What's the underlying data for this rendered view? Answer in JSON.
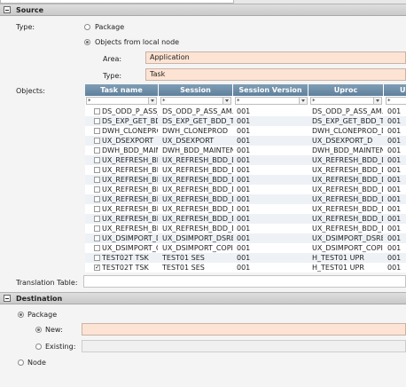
{
  "source": {
    "title": "Source",
    "type_label": "Type:",
    "type_options": [
      "Package",
      "Objects from local node"
    ],
    "area_label": "Area:",
    "area_value": "Application",
    "objtype_label": "Type:",
    "objtype_value": "Task",
    "objects_label": "Objects:",
    "translation_label": "Translation Table:"
  },
  "grid": {
    "columns": [
      "Task name",
      "Session",
      "Session Version",
      "Uproc",
      "Up"
    ],
    "filters": [
      "*",
      "*",
      "*",
      "*",
      "*"
    ],
    "rows": [
      {
        "checked": false,
        "task": "DS_ODD_P_ASS_AM",
        "session": "DS_ODD_P_ASS_AM...",
        "version": "001",
        "uproc": "DS_ODD_P_ASS_AM...",
        "uv": "001"
      },
      {
        "checked": false,
        "task": "DS_EXP_GET_BDD",
        "session": "DS_EXP_GET_BDD_T...",
        "version": "001",
        "uproc": "DS_EXP_GET_BDD_T...",
        "uv": "001"
      },
      {
        "checked": false,
        "task": "DWH_CLONEPROD",
        "session": "DWH_CLONEPROD",
        "version": "001",
        "uproc": "DWH_CLONEPROD_D",
        "uv": "001"
      },
      {
        "checked": false,
        "task": "UX_DSEXPORT",
        "session": "UX_DSEXPORT",
        "version": "001",
        "uproc": "UX_DSEXPORT_D",
        "uv": "001"
      },
      {
        "checked": false,
        "task": "DWH_BDD_MAIN",
        "session": "DWH_BDD_MAINTEN...",
        "version": "001",
        "uproc": "DWH_BDD_MAINTEN...",
        "uv": "001"
      },
      {
        "checked": false,
        "task": "UX_REFRESH_BD",
        "session": "UX_REFRESH_BDD_D...",
        "version": "001",
        "uproc": "UX_REFRESH_BDD_D...",
        "uv": "001"
      },
      {
        "checked": false,
        "task": "UX_REFRESH_BD",
        "session": "UX_REFRESH_BDD_D...",
        "version": "001",
        "uproc": "UX_REFRESH_BDD_D...",
        "uv": "001"
      },
      {
        "checked": false,
        "task": "UX_REFRESH_BD",
        "session": "UX_REFRESH_BDD_D...",
        "version": "001",
        "uproc": "UX_REFRESH_BDD_D...",
        "uv": "001"
      },
      {
        "checked": false,
        "task": "UX_REFRESH_BD",
        "session": "UX_REFRESH_BDD_D...",
        "version": "001",
        "uproc": "UX_REFRESH_BDD_D...",
        "uv": "001"
      },
      {
        "checked": false,
        "task": "UX_REFRESH_BD",
        "session": "UX_REFRESH_BDD_D...",
        "version": "001",
        "uproc": "UX_REFRESH_BDD_D...",
        "uv": "001"
      },
      {
        "checked": false,
        "task": "UX_REFRESH_BD",
        "session": "UX_REFRESH_BDD_D...",
        "version": "001",
        "uproc": "UX_REFRESH_BDD_D...",
        "uv": "001"
      },
      {
        "checked": false,
        "task": "UX_REFRESH_BD",
        "session": "UX_REFRESH_BDD_D...",
        "version": "001",
        "uproc": "UX_REFRESH_BDD_D...",
        "uv": "001"
      },
      {
        "checked": false,
        "task": "UX_REFRESH_BD",
        "session": "UX_REFRESH_BDD_D...",
        "version": "001",
        "uproc": "UX_REFRESH_BDD_D...",
        "uv": "001"
      },
      {
        "checked": false,
        "task": "UX_DSIMPORT_D",
        "session": "UX_DSIMPORT_DSRE...",
        "version": "001",
        "uproc": "UX_DSIMPORT_DSRE...",
        "uv": "001"
      },
      {
        "checked": false,
        "task": "UX_DSIMPORT_C",
        "session": "UX_DSIMPORT_COPI...",
        "version": "001",
        "uproc": "UX_DSIMPORT_COPI...",
        "uv": "001"
      },
      {
        "checked": false,
        "task": "TEST02T TSK",
        "session": "TEST01 SES",
        "version": "001",
        "uproc": "H_TEST01 UPR",
        "uv": "001"
      },
      {
        "checked": true,
        "task": "TEST02T TSK",
        "session": "TEST01 SES",
        "version": "001",
        "uproc": "H_TEST01 UPR",
        "uv": "001"
      }
    ]
  },
  "destination": {
    "title": "Destination",
    "package_label": "Package",
    "new_label": "New:",
    "existing_label": "Existing:",
    "node_label": "Node"
  },
  "colors": {
    "header_bg": "#6b8ba6",
    "required_field": "#fde3d3",
    "section_bg": "#d4d4d4"
  }
}
